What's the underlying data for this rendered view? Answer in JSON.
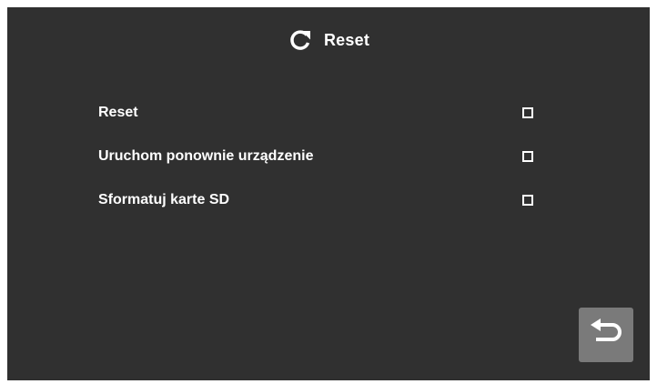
{
  "header": {
    "title": "Reset",
    "icon": "refresh-icon"
  },
  "options": [
    {
      "label": "Reset",
      "checked": false
    },
    {
      "label": "Uruchom ponownie urządzenie",
      "checked": false
    },
    {
      "label": "Sformatuj karte SD",
      "checked": false
    }
  ],
  "back_button": {
    "icon": "return-arrow-icon"
  },
  "colors": {
    "background": "#303030",
    "text": "#ffffff",
    "button": "#7a7a7a"
  }
}
